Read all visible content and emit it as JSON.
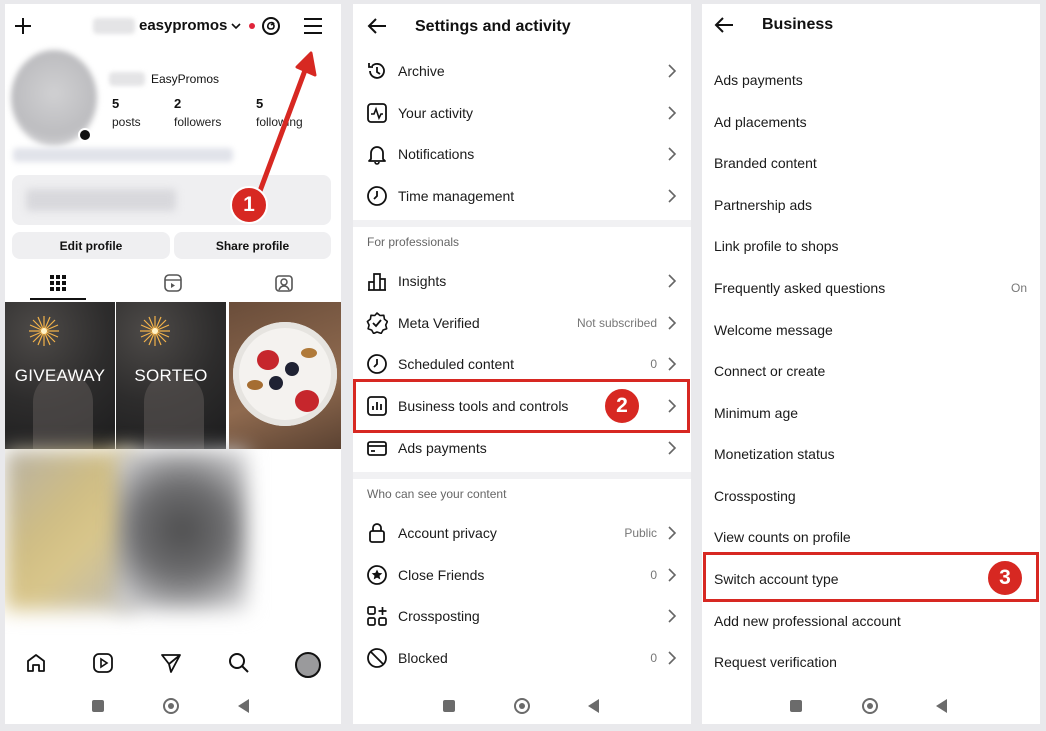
{
  "profile": {
    "username": "easypromos",
    "display_name": "EasyPromos",
    "stats": [
      {
        "num": "5",
        "label": "posts"
      },
      {
        "num": "2",
        "label": "followers"
      },
      {
        "num": "5",
        "label": "following"
      }
    ],
    "buttons": {
      "edit": "Edit profile",
      "share": "Share profile"
    },
    "tiles": [
      {
        "text": "GIVEAWAY"
      },
      {
        "text": "SORTEO"
      }
    ]
  },
  "settings": {
    "title": "Settings and activity",
    "top_items": [
      {
        "label": "Archive",
        "icon": "archive-icon"
      },
      {
        "label": "Your activity",
        "icon": "activity-icon"
      },
      {
        "label": "Notifications",
        "icon": "bell-icon"
      },
      {
        "label": "Time management",
        "icon": "clock-icon"
      }
    ],
    "section_professionals": "For professionals",
    "pro_items": [
      {
        "label": "Insights",
        "value": "",
        "icon": "insights-icon"
      },
      {
        "label": "Meta Verified",
        "value": "Not subscribed",
        "icon": "verified-icon"
      },
      {
        "label": "Scheduled content",
        "value": "0",
        "icon": "clock-icon"
      },
      {
        "label": "Business tools and controls",
        "value": "",
        "icon": "chart-icon"
      },
      {
        "label": "Ads payments",
        "value": "",
        "icon": "card-icon"
      }
    ],
    "section_visibility": "Who can see your content",
    "vis_items": [
      {
        "label": "Account privacy",
        "value": "Public",
        "icon": "lock-icon"
      },
      {
        "label": "Close Friends",
        "value": "0",
        "icon": "star-icon"
      },
      {
        "label": "Crossposting",
        "value": "",
        "icon": "crosspost-icon"
      },
      {
        "label": "Blocked",
        "value": "0",
        "icon": "blocked-icon"
      }
    ]
  },
  "business": {
    "title": "Business",
    "items": [
      {
        "label": "Ads payments",
        "value": ""
      },
      {
        "label": "Ad placements",
        "value": ""
      },
      {
        "label": "Branded content",
        "value": ""
      },
      {
        "label": "Partnership ads",
        "value": ""
      },
      {
        "label": "Link profile to shops",
        "value": ""
      },
      {
        "label": "Frequently asked questions",
        "value": "On"
      },
      {
        "label": "Welcome message",
        "value": ""
      },
      {
        "label": "Connect or create",
        "value": ""
      },
      {
        "label": "Minimum age",
        "value": ""
      },
      {
        "label": "Monetization status",
        "value": ""
      },
      {
        "label": "Crossposting",
        "value": ""
      },
      {
        "label": "View counts on profile",
        "value": ""
      },
      {
        "label": "Switch account type",
        "value": ""
      },
      {
        "label": "Add new professional account",
        "value": ""
      },
      {
        "label": "Request verification",
        "value": ""
      }
    ]
  },
  "steps": [
    "1",
    "2",
    "3"
  ],
  "colors": {
    "highlight": "#d72822",
    "text": "#1a1a1a",
    "muted": "#777777",
    "separator": "#f1f1f3"
  }
}
